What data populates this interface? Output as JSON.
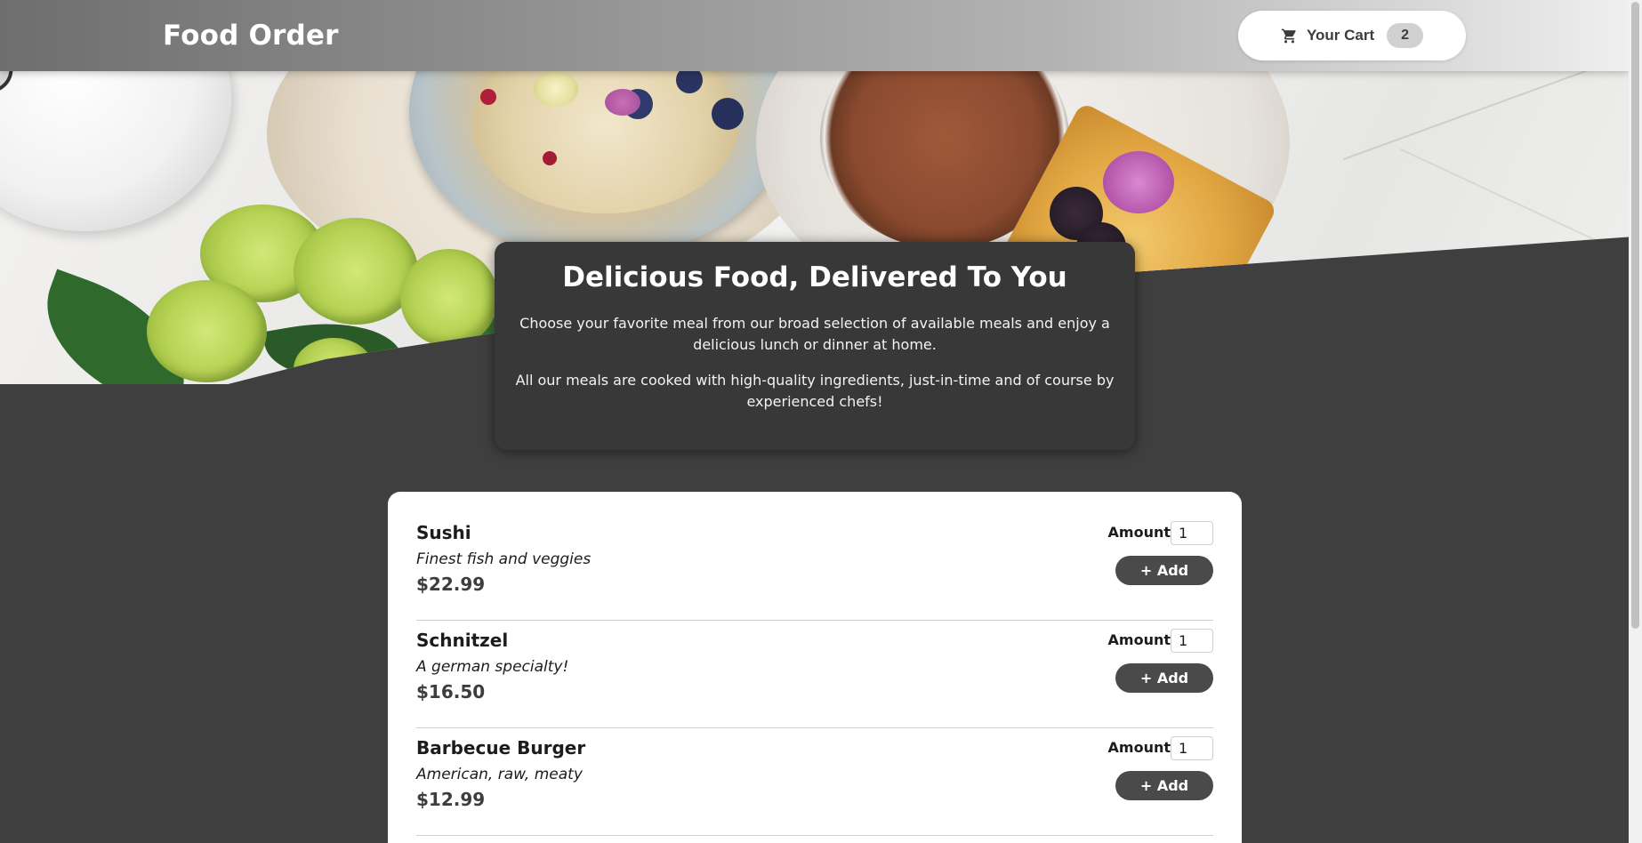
{
  "header": {
    "title": "Food Order",
    "cart": {
      "label": "Your Cart",
      "count": "2",
      "icon": "cart-icon"
    }
  },
  "summary": {
    "heading": "Delicious Food, Delivered To You",
    "paragraph_1": "Choose your favorite meal from our broad selection of available meals and enjoy a delicious lunch or dinner at home.",
    "paragraph_2": "All our meals are cooked with high-quality ingredients, just-in-time and of course by experienced chefs!"
  },
  "meals": [
    {
      "name": "Sushi",
      "description": "Finest fish and veggies",
      "price": "$22.99",
      "amount_label": "Amount",
      "amount_value": "1",
      "add_label": "+ Add"
    },
    {
      "name": "Schnitzel",
      "description": "A german specialty!",
      "price": "$16.50",
      "amount_label": "Amount",
      "amount_value": "1",
      "add_label": "+ Add"
    },
    {
      "name": "Barbecue Burger",
      "description": "American, raw, meaty",
      "price": "$12.99",
      "amount_label": "Amount",
      "amount_value": "1",
      "add_label": "+ Add"
    }
  ],
  "colors": {
    "background": "#3f3f3f",
    "summary_card": "#383838",
    "button": "#4a4a4a",
    "price_text": "#3d3d3d"
  }
}
